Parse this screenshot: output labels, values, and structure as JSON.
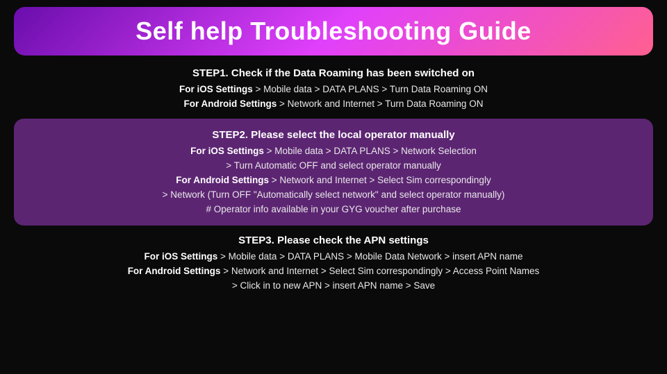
{
  "title": "Self help Troubleshooting Guide",
  "steps": [
    {
      "id": "step1",
      "title": "STEP1. Check if the Data Roaming has been switched on",
      "highlighted": false,
      "lines": [
        {
          "bold": "For iOS Settings",
          "rest": " > Mobile data > DATA PLANS > Turn Data Roaming ON"
        },
        {
          "bold": "For Android Settings",
          "rest": " > Network and Internet > Turn Data Roaming ON"
        }
      ]
    },
    {
      "id": "step2",
      "title": "STEP2. Please select the local operator manually",
      "highlighted": true,
      "lines": [
        {
          "bold": "For iOS Settings",
          "rest": " > Mobile data > DATA PLANS > Network Selection"
        },
        {
          "bold": "",
          "rest": " > Turn Automatic OFF and select operator manually"
        },
        {
          "bold": "For Android Settings",
          "rest": " > Network and Internet > Select Sim correspondingly"
        },
        {
          "bold": "",
          "rest": " > Network (Turn OFF \"Automatically select network\" and select operator manually)"
        },
        {
          "bold": "",
          "rest": " # Operator info available in your GYG voucher after purchase"
        }
      ]
    },
    {
      "id": "step3",
      "title": "STEP3. Please check the APN settings",
      "highlighted": false,
      "lines": [
        {
          "bold": "For iOS Settings",
          "rest": " > Mobile data > DATA PLANS > Mobile Data Network > insert APN name"
        },
        {
          "bold": "For Android Settings",
          "rest": " > Network and Internet > Select Sim correspondingly > Access Point Names"
        },
        {
          "bold": "",
          "rest": " > Click in to new APN > insert APN name > Save"
        }
      ]
    }
  ]
}
